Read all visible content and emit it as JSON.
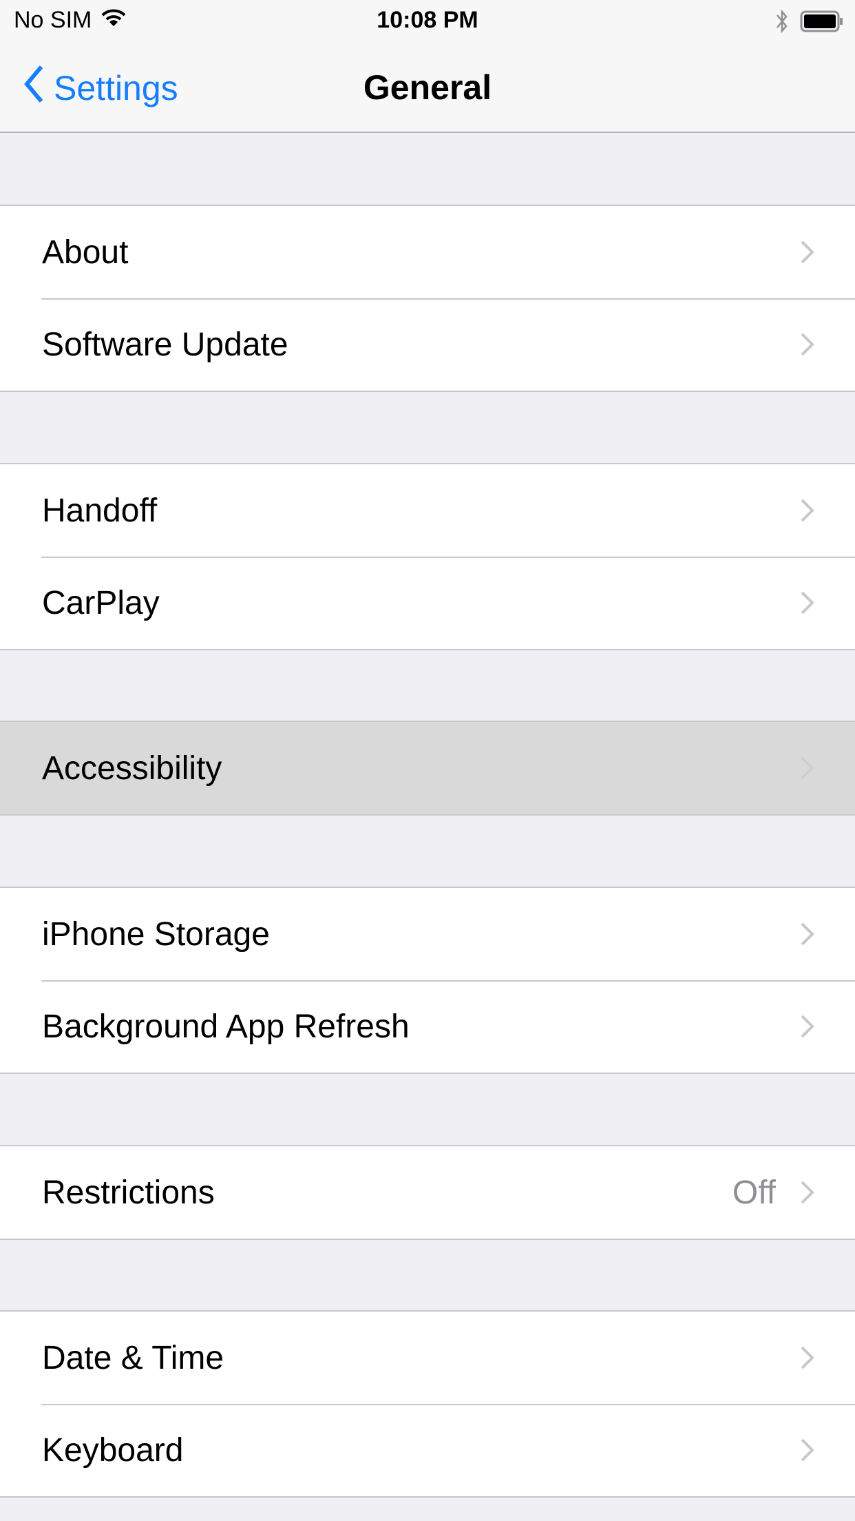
{
  "status_bar": {
    "carrier": "No SIM",
    "time": "10:08 PM",
    "icons": [
      "wifi-icon",
      "bluetooth-icon",
      "battery-icon"
    ]
  },
  "nav": {
    "back_label": "Settings",
    "title": "General"
  },
  "groups": [
    {
      "rows": [
        {
          "label": "About"
        },
        {
          "label": "Software Update"
        }
      ]
    },
    {
      "rows": [
        {
          "label": "Handoff"
        },
        {
          "label": "CarPlay"
        }
      ]
    },
    {
      "rows": [
        {
          "label": "Accessibility",
          "selected": true
        }
      ]
    },
    {
      "rows": [
        {
          "label": "iPhone Storage"
        },
        {
          "label": "Background App Refresh"
        }
      ]
    },
    {
      "rows": [
        {
          "label": "Restrictions",
          "value": "Off"
        }
      ]
    },
    {
      "rows": [
        {
          "label": "Date & Time"
        },
        {
          "label": "Keyboard"
        }
      ]
    }
  ],
  "colors": {
    "accent": "#157efb",
    "background": "#efeff4",
    "selected_row": "#d9d9d9",
    "secondary_text": "#8e8e93",
    "chevron": "#c7c7cc"
  }
}
